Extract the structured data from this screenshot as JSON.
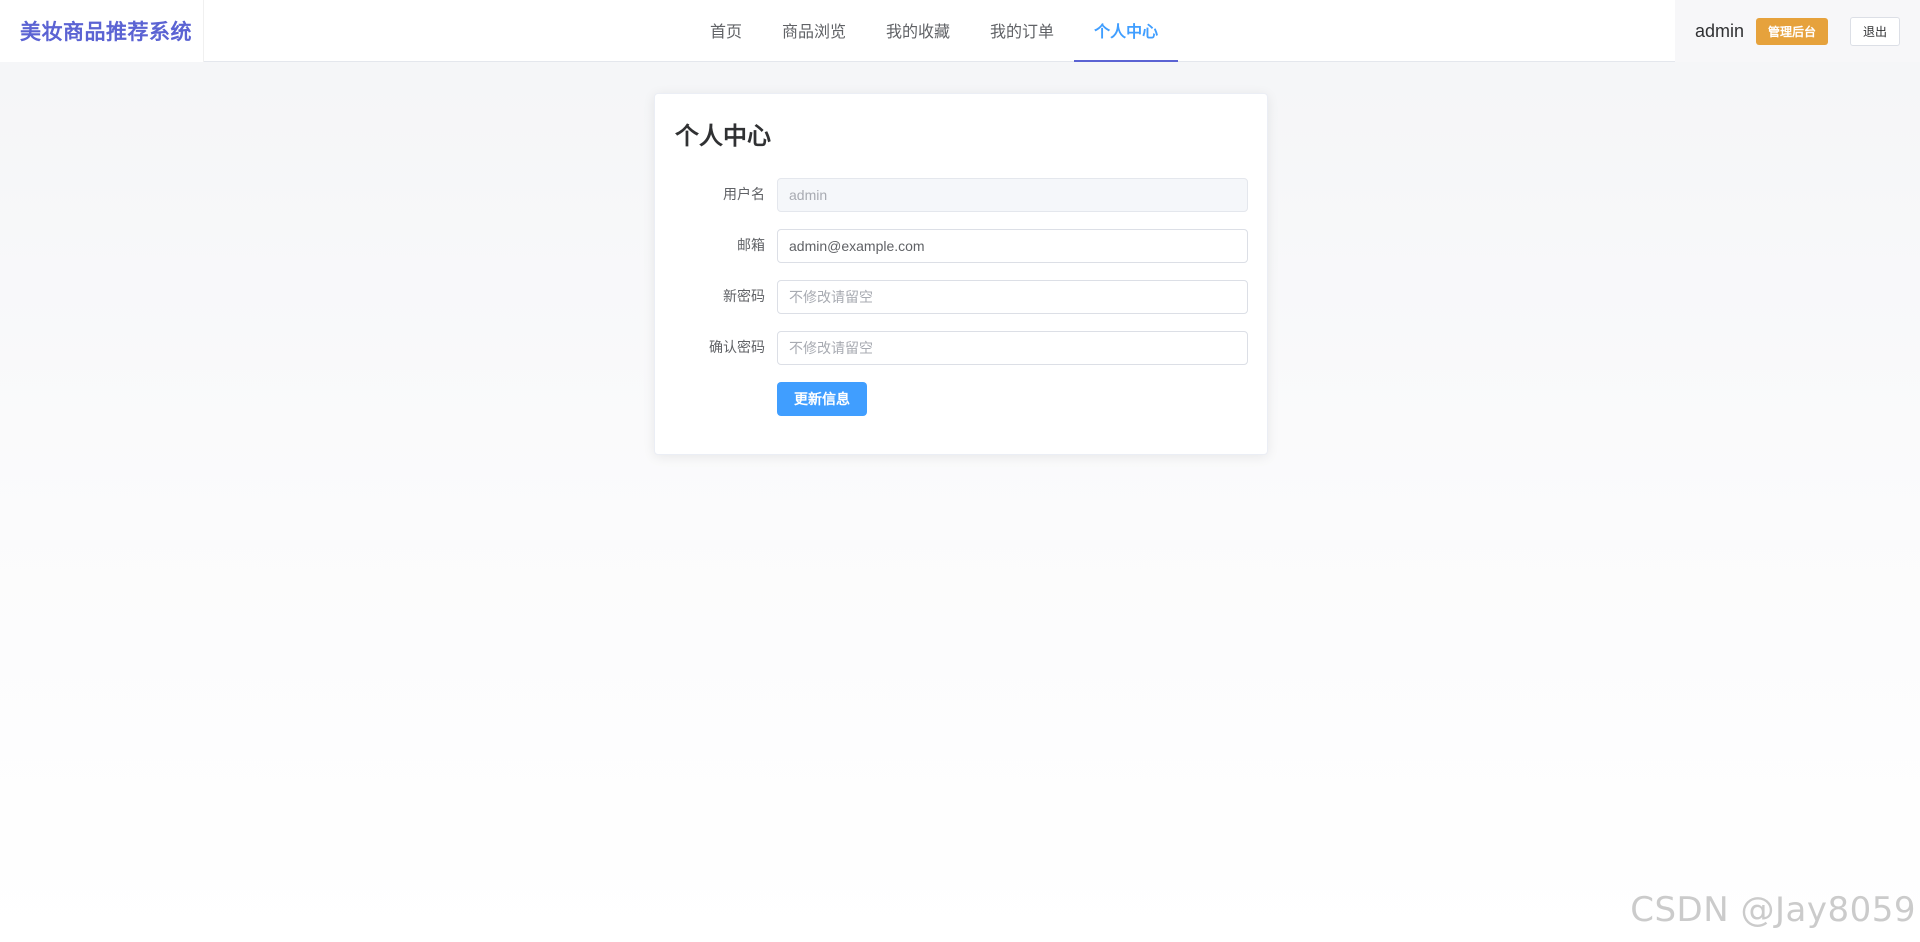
{
  "app": {
    "logo": "美妆商品推荐系统"
  },
  "nav": {
    "items": [
      {
        "label": "首页"
      },
      {
        "label": "商品浏览"
      },
      {
        "label": "我的收藏"
      },
      {
        "label": "我的订单"
      },
      {
        "label": "个人中心",
        "active": true
      }
    ]
  },
  "user": {
    "name": "admin",
    "admin_badge": "管理后台",
    "logout": "退出"
  },
  "profile": {
    "title": "个人中心",
    "fields": {
      "username": {
        "label": "用户名",
        "value": "admin"
      },
      "email": {
        "label": "邮箱",
        "value": "admin@example.com"
      },
      "new_password": {
        "label": "新密码",
        "placeholder": "不修改请留空"
      },
      "confirm_password": {
        "label": "确认密码",
        "placeholder": "不修改请留空"
      }
    },
    "submit": "更新信息"
  },
  "watermark": "CSDN @Jay8059",
  "colors": {
    "brand": "#5b63d3",
    "primary": "#409eff",
    "warning": "#e6a23c"
  }
}
